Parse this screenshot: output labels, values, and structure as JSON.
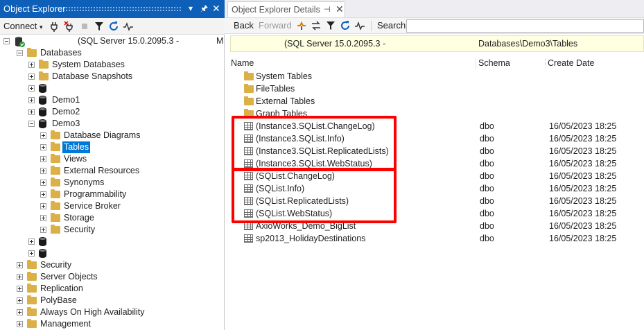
{
  "left": {
    "title": "Object Explorer",
    "toolbar": {
      "connect": "Connect"
    },
    "server_label": "(SQL Server 15.0.2095.3 -",
    "server_suffix": "M",
    "tree": [
      {
        "label": "Databases",
        "expander": "minus",
        "icon": "folder",
        "indent": 1
      },
      {
        "label": "System Databases",
        "expander": "plus",
        "icon": "folder",
        "indent": 2
      },
      {
        "label": "Database Snapshots",
        "expander": "plus",
        "icon": "folder",
        "indent": 2
      },
      {
        "label": "",
        "expander": "plus",
        "icon": "database",
        "indent": 2
      },
      {
        "label": "Demo1",
        "expander": "plus",
        "icon": "database",
        "indent": 2
      },
      {
        "label": "Demo2",
        "expander": "plus",
        "icon": "database",
        "indent": 2
      },
      {
        "label": "Demo3",
        "expander": "minus",
        "icon": "database",
        "indent": 2
      },
      {
        "label": "Database Diagrams",
        "expander": "plus",
        "icon": "folder",
        "indent": 3
      },
      {
        "label": "Tables",
        "expander": "plus",
        "icon": "folder",
        "indent": 3,
        "selected": true
      },
      {
        "label": "Views",
        "expander": "plus",
        "icon": "folder",
        "indent": 3
      },
      {
        "label": "External Resources",
        "expander": "plus",
        "icon": "folder",
        "indent": 3
      },
      {
        "label": "Synonyms",
        "expander": "plus",
        "icon": "folder",
        "indent": 3
      },
      {
        "label": "Programmability",
        "expander": "plus",
        "icon": "folder",
        "indent": 3
      },
      {
        "label": "Service Broker",
        "expander": "plus",
        "icon": "folder",
        "indent": 3
      },
      {
        "label": "Storage",
        "expander": "plus",
        "icon": "folder",
        "indent": 3
      },
      {
        "label": "Security",
        "expander": "plus",
        "icon": "folder",
        "indent": 3
      },
      {
        "label": "",
        "expander": "plus",
        "icon": "database",
        "indent": 2
      },
      {
        "label": "",
        "expander": "plus",
        "icon": "database",
        "indent": 2
      },
      {
        "label": "Security",
        "expander": "plus",
        "icon": "folder",
        "indent": 1
      },
      {
        "label": "Server Objects",
        "expander": "plus",
        "icon": "folder",
        "indent": 1
      },
      {
        "label": "Replication",
        "expander": "plus",
        "icon": "folder",
        "indent": 1
      },
      {
        "label": "PolyBase",
        "expander": "plus",
        "icon": "folder",
        "indent": 1
      },
      {
        "label": "Always On High Availability",
        "expander": "plus",
        "icon": "folder",
        "indent": 1
      },
      {
        "label": "Management",
        "expander": "plus",
        "icon": "folder",
        "indent": 1
      }
    ]
  },
  "right": {
    "tab_title": "Object Explorer Details",
    "toolbar": {
      "back": "Back",
      "forward": "Forward",
      "search": "Search",
      "search_value": ""
    },
    "path": {
      "server": "(SQL Server 15.0.2095.3 -",
      "location": "Databases\\Demo3\\Tables"
    },
    "columns": [
      "Name",
      "Schema",
      "Create Date"
    ],
    "rows": [
      {
        "name": "System Tables",
        "schema": "",
        "date": "",
        "icon": "folder"
      },
      {
        "name": "FileTables",
        "schema": "",
        "date": "",
        "icon": "folder"
      },
      {
        "name": "External Tables",
        "schema": "",
        "date": "",
        "icon": "folder"
      },
      {
        "name": "Graph Tables",
        "schema": "",
        "date": "",
        "icon": "folder"
      },
      {
        "name": "(Instance3.SQList.ChangeLog)",
        "schema": "dbo",
        "date": "16/05/2023 18:25",
        "icon": "table"
      },
      {
        "name": "(Instance3.SQList.Info)",
        "schema": "dbo",
        "date": "16/05/2023 18:25",
        "icon": "table"
      },
      {
        "name": "(Instance3.SQList.ReplicatedLists)",
        "schema": "dbo",
        "date": "16/05/2023 18:25",
        "icon": "table"
      },
      {
        "name": "(Instance3.SQList.WebStatus)",
        "schema": "dbo",
        "date": "16/05/2023 18:25",
        "icon": "table"
      },
      {
        "name": "(SQList.ChangeLog)",
        "schema": "dbo",
        "date": "16/05/2023 18:25",
        "icon": "table"
      },
      {
        "name": "(SQList.Info)",
        "schema": "dbo",
        "date": "16/05/2023 18:25",
        "icon": "table"
      },
      {
        "name": "(SQList.ReplicatedLists)",
        "schema": "dbo",
        "date": "16/05/2023 18:25",
        "icon": "table"
      },
      {
        "name": "(SQList.WebStatus)",
        "schema": "dbo",
        "date": "16/05/2023 18:25",
        "icon": "table"
      },
      {
        "name": "AxioWorks_Demo_BigList",
        "schema": "dbo",
        "date": "16/05/2023 18:25",
        "icon": "table"
      },
      {
        "name": "sp2013_HolidayDestinations",
        "schema": "dbo",
        "date": "16/05/2023 18:25",
        "icon": "table"
      }
    ]
  },
  "colors": {
    "accent": "#0e5fb8",
    "selection": "#0078d7",
    "highlight": "#ff0000",
    "folder": "#dcb048",
    "pathbar": "#ffffe1"
  }
}
